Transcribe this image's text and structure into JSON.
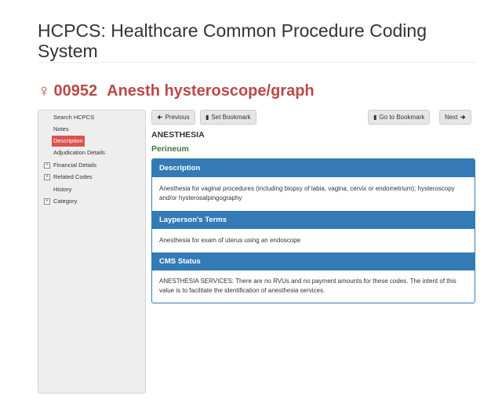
{
  "page": {
    "title": "HCPCS: Healthcare Common Procedure Coding System"
  },
  "code": {
    "icon": "female-symbol-icon",
    "number": "00952",
    "short_desc": "Anesth hysteroscope/graph",
    "color": "#b94a48"
  },
  "sidebar": {
    "items": [
      {
        "label": "Search HCPCS",
        "expandable": false,
        "active": false
      },
      {
        "label": "Notes",
        "expandable": false,
        "active": false
      },
      {
        "label": "Description",
        "expandable": false,
        "active": true
      },
      {
        "label": "Adjudication Details",
        "expandable": false,
        "active": false
      },
      {
        "label": "Financial Details",
        "expandable": true,
        "active": false
      },
      {
        "label": "Related Codes",
        "expandable": true,
        "active": false
      },
      {
        "label": "History",
        "expandable": false,
        "active": false
      },
      {
        "label": "Category",
        "expandable": true,
        "active": false
      }
    ],
    "expand_glyph": "+",
    "active_color": "#d9534f"
  },
  "toolbar": {
    "previous_label": "Previous",
    "set_bookmark_label": "Set Bookmark",
    "go_to_bookmark_label": "Go to Bookmark",
    "next_label": "Next"
  },
  "content": {
    "category": "ANESTHESIA",
    "subcategory": "Perineum",
    "sections": [
      {
        "heading": "Description",
        "body": "Anesthesia for vaginal procedures (including biopsy of labia, vagina, cervix or endometrium); hysteroscopy and/or hysterosalpingography"
      },
      {
        "heading": "Layperson's Terms",
        "body": "Anesthesia for exam of uterus using an endoscope"
      },
      {
        "heading": "CMS Status",
        "body": "ANESTHESIA SERVICES: There are no RVUs and no payment amounts for these codes. The intent of this value is to facilitate the identification of anesthesia services."
      }
    ],
    "panel_color": "#337ab7",
    "subcategory_color": "#3c763d"
  }
}
